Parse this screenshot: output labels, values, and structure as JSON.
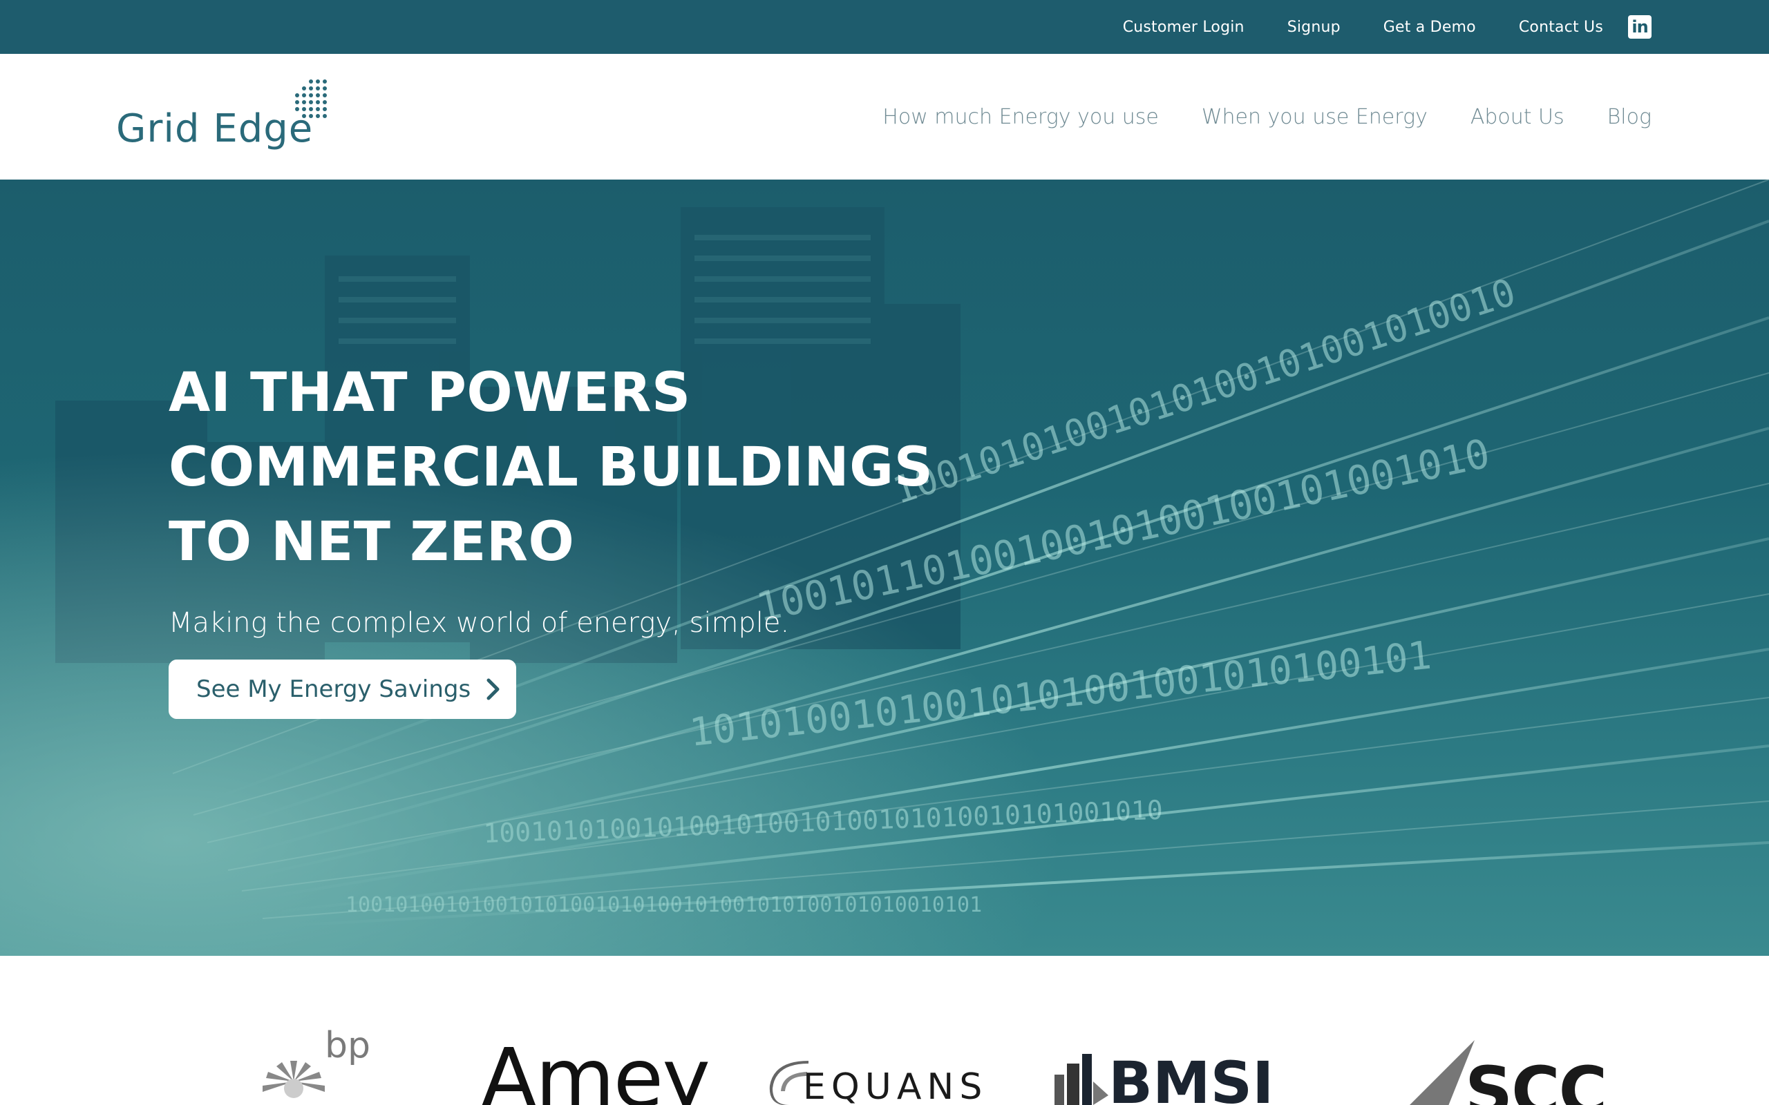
{
  "topbar": {
    "links": [
      "Customer Login",
      "Signup",
      "Get a Demo",
      "Contact Us"
    ],
    "social_icon": "linkedin-icon",
    "social_glyph": "in",
    "background": "#1e5c6d"
  },
  "header": {
    "logo_text": "Grid Edge",
    "nav": [
      "How much Energy you use",
      "When you use Energy",
      "About Us",
      "Blog"
    ]
  },
  "hero": {
    "title_lines": [
      "AI THAT POWERS",
      "COMMERCIAL BUILDINGS",
      "TO NET ZERO"
    ],
    "subtitle": "Making the complex world of energy, simple.",
    "cta_label": "See My Energy Savings",
    "cta_icon": "chevron-right-icon"
  },
  "partners": {
    "logos": [
      {
        "name": "bp",
        "text": "bp"
      },
      {
        "name": "amey",
        "text": "Amey"
      },
      {
        "name": "equans",
        "text": "EQUANS"
      },
      {
        "name": "bmsi",
        "text": "BMSI"
      },
      {
        "name": "scc",
        "text": "SCC"
      }
    ]
  },
  "colors": {
    "brand_dark": "#1e5c6d",
    "hero_teal": "#2a7580",
    "nav_text": "#6f8a93",
    "logo_text": "#2a6a7a"
  }
}
